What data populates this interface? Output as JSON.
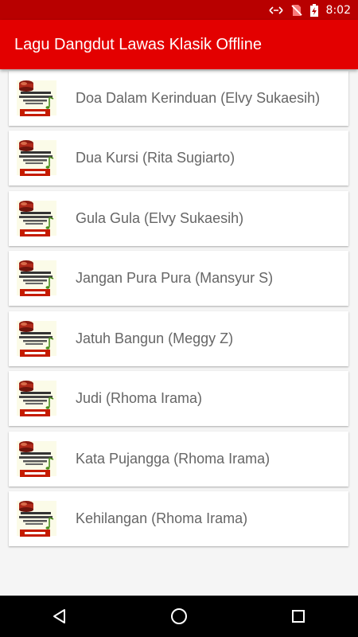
{
  "status_bar": {
    "time": "8:02",
    "icons": [
      "data-transfer-icon",
      "no-sim-icon",
      "battery-charging-icon"
    ]
  },
  "app_bar": {
    "title": "Lagu Dangdut Lawas Klasik Offline"
  },
  "thumbnail": {
    "badge_text": "Dangdut",
    "logo_text": "Lagu Dangdut Lawas Offline Musik",
    "icon": "app-logo-icon"
  },
  "songs": [
    {
      "title": "Doa Dalam Kerinduan (Elvy Sukaesih)"
    },
    {
      "title": "Dua Kursi (Rita Sugiarto)"
    },
    {
      "title": "Gula Gula (Elvy Sukaesih)"
    },
    {
      "title": "Jangan Pura Pura (Mansyur S)"
    },
    {
      "title": "Jatuh Bangun (Meggy Z)"
    },
    {
      "title": "Judi (Rhoma Irama)"
    },
    {
      "title": "Kata Pujangga (Rhoma Irama)"
    },
    {
      "title": "Kehilangan (Rhoma Irama)"
    }
  ],
  "nav_bar": {
    "icons": [
      "back-icon",
      "home-icon",
      "recents-icon"
    ]
  },
  "colors": {
    "app_bar": "#e30000",
    "status_bar": "#b80000",
    "background": "#f5f5f5",
    "card": "#ffffff",
    "text": "#666666"
  }
}
